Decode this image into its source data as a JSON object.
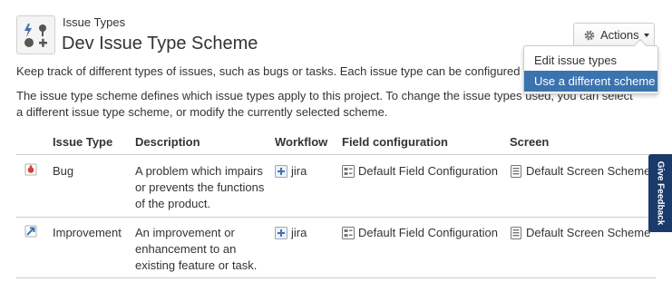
{
  "header": {
    "breadcrumb": "Issue Types",
    "title": "Dev Issue Type Scheme",
    "actions_label": "Actions",
    "icon": "issue-types-icon"
  },
  "dropdown": {
    "items": [
      {
        "label": "Edit issue types"
      },
      {
        "label": "Use a different scheme"
      }
    ]
  },
  "description": {
    "line1": "Keep track of different types of issues, such as bugs or tasks. Each issue type can be configured diffe",
    "line2": "The issue type scheme defines which issue types apply to this project. To change the issue types used, you can select a different issue type scheme, or modify the currently selected scheme."
  },
  "table": {
    "headers": [
      "Issue Type",
      "Description",
      "Workflow",
      "Field configuration",
      "Screen"
    ],
    "rows": [
      {
        "type": "Bug",
        "icon": "bug-icon",
        "description": "A problem which impairs or prevents the functions of the product.",
        "workflow": "jira",
        "field_configuration": "Default Field Configuration",
        "screen": "Default Screen Scheme"
      },
      {
        "type": "Improvement",
        "icon": "improvement-icon",
        "description": "An improvement or enhancement to an existing feature or task.",
        "workflow": "jira",
        "field_configuration": "Default Field Configuration",
        "screen": "Default Screen Scheme"
      }
    ]
  },
  "feedback_label": "Give Feedback",
  "colors": {
    "link": "#3b73af",
    "highlight": "#3b73af",
    "feedback_bg": "#1a3a6b"
  }
}
